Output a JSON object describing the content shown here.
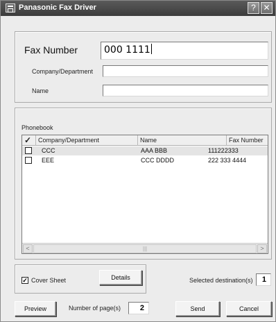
{
  "window": {
    "title": "Panasonic Fax Driver",
    "help_label": "?",
    "close_label": "✕"
  },
  "form": {
    "fax_number_label": "Fax Number",
    "fax_number_value": "000 1111",
    "company_label": "Company/Department",
    "company_value": "",
    "name_label": "Name",
    "name_value": ""
  },
  "phonebook": {
    "label": "Phonebook",
    "columns": {
      "check": "✓",
      "company": "Company/Department",
      "name": "Name",
      "fax": "Fax Number"
    },
    "rows": [
      {
        "checked": false,
        "company": "CCC",
        "name": "AAA BBB",
        "fax": "111222333"
      },
      {
        "checked": false,
        "company": "EEE",
        "name": "CCC DDDD",
        "fax": "222 333 4444"
      }
    ],
    "scroll_left": "<",
    "scroll_right": ">",
    "scroll_grip": "|||"
  },
  "cover_sheet": {
    "checked": true,
    "check_mark": "✓",
    "label": "Cover Sheet",
    "details_label": "Details"
  },
  "destinations": {
    "label": "Selected destination(s)",
    "value": "1"
  },
  "bottom": {
    "preview_label": "Preview",
    "pages_label": "Number of page(s)",
    "pages_value": "2",
    "send_label": "Send",
    "cancel_label": "Cancel"
  }
}
